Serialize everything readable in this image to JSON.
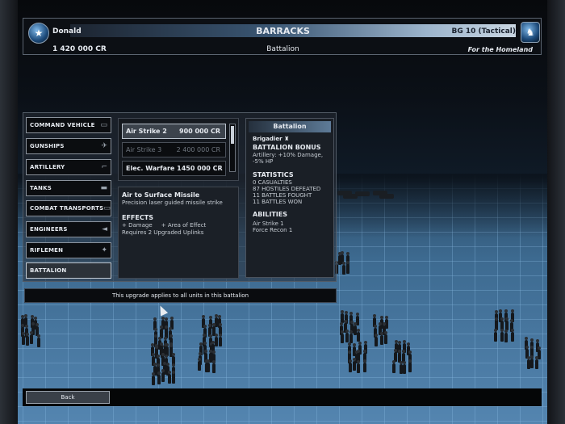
{
  "header": {
    "player_name": "Donald",
    "credits": "1 420 000 CR",
    "title": "BARRACKS",
    "subtitle": "Battalion",
    "battlegroup": "BG 10 (Tactical)",
    "motto": "For the Homeland"
  },
  "categories": [
    {
      "label": "COMMAND VEHICLE",
      "icon": "command-vehicle-icon",
      "glyph": "▭"
    },
    {
      "label": "GUNSHIPS",
      "icon": "gunship-icon",
      "glyph": "✈"
    },
    {
      "label": "ARTILLERY",
      "icon": "artillery-icon",
      "glyph": "⌐"
    },
    {
      "label": "TANKS",
      "icon": "tank-icon",
      "glyph": "▬"
    },
    {
      "label": "COMBAT TRANSPORTS",
      "icon": "transport-icon",
      "glyph": "▭"
    },
    {
      "label": "ENGINEERS",
      "icon": "engineer-icon",
      "glyph": "◄"
    },
    {
      "label": "RIFLEMEN",
      "icon": "rifleman-icon",
      "glyph": "✦"
    },
    {
      "label": "BATTALION",
      "icon": "",
      "glyph": ""
    }
  ],
  "selected_category": "BATTALION",
  "upgrades": [
    {
      "name": "Air Strike 2",
      "price": "900 000 CR",
      "state": "selected"
    },
    {
      "name": "Air Strike 3",
      "price": "2 400 000 CR",
      "state": "disabled"
    },
    {
      "name": "Elec. Warfare 1",
      "price": "450 000 CR",
      "state": "normal"
    }
  ],
  "detail": {
    "title": "Air to Surface Missile",
    "description": "Precision laser guided missile strike",
    "effects_heading": "EFFECTS",
    "effects": "+ Damage     + Area of Effect",
    "requirement": "Requires 2 Upgraded Uplinks"
  },
  "battalion": {
    "heading": "Battalion",
    "rank": "Brigadier",
    "bonus_heading": "BATTALION BONUS",
    "bonus_text": "Artillery: +10% Damage, -5% HP",
    "stats_heading": "STATISTICS",
    "stats": [
      "0 CASUALTIES",
      "87 HOSTILES DEFEATED",
      "11 BATTLES FOUGHT",
      "11 BATTLES WON"
    ],
    "abilities_heading": "ABILITIES",
    "abilities": [
      "Air Strike 1",
      "Force Recon 1"
    ]
  },
  "notice": "This upgrade applies to all units in this battalion",
  "back_label": "Back",
  "colors": {
    "accent_bar": "#3a5673",
    "panel_bg": "#1a1f26",
    "floor": "#5485b0"
  }
}
